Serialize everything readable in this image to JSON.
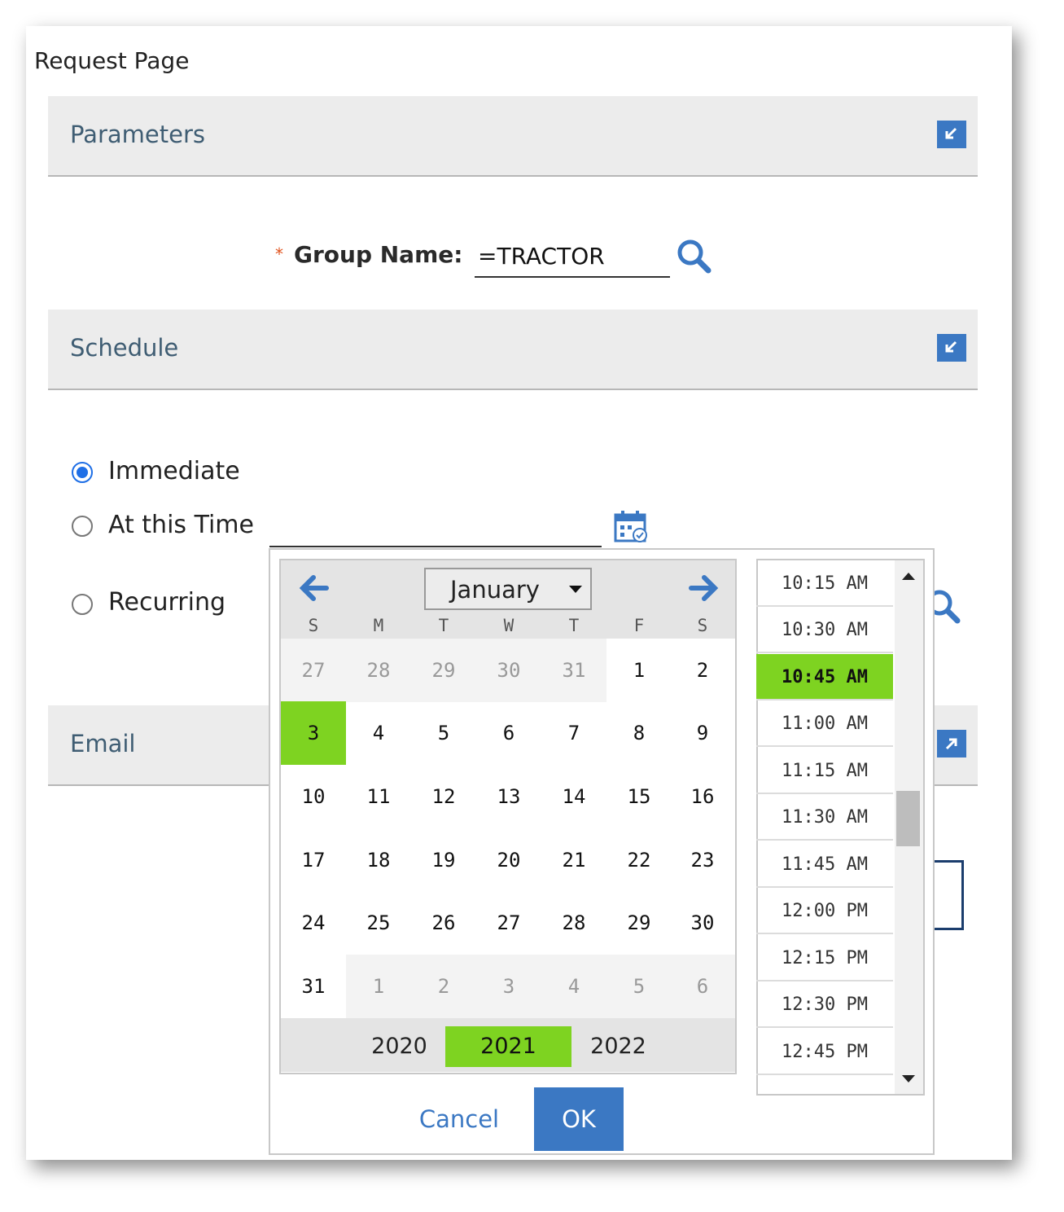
{
  "page_title": "Request Page",
  "sections": {
    "parameters": "Parameters",
    "schedule": "Schedule",
    "email": "Email"
  },
  "group": {
    "required_marker": "*",
    "label": "Group Name:",
    "value": "=TRACTOR"
  },
  "schedule": {
    "options": [
      "Immediate",
      "At this Time",
      "Recurring"
    ],
    "selected": "Immediate"
  },
  "calendar": {
    "month": "January",
    "weekdays": [
      "S",
      "M",
      "T",
      "W",
      "T",
      "F",
      "S"
    ],
    "days": [
      "27",
      "28",
      "29",
      "30",
      "31",
      "1",
      "2",
      "3",
      "4",
      "5",
      "6",
      "7",
      "8",
      "9",
      "10",
      "11",
      "12",
      "13",
      "14",
      "15",
      "16",
      "17",
      "18",
      "19",
      "20",
      "21",
      "22",
      "23",
      "24",
      "25",
      "26",
      "27",
      "28",
      "29",
      "30",
      "31",
      "1",
      "2",
      "3",
      "4",
      "5",
      "6"
    ],
    "selected_day": "3",
    "years": [
      "2020",
      "2021",
      "2022"
    ],
    "selected_year": "2021"
  },
  "times": {
    "items": [
      "10:15 AM",
      "10:30 AM",
      "10:45 AM",
      "11:00 AM",
      "11:15 AM",
      "11:30 AM",
      "11:45 AM",
      "12:00 PM",
      "12:15 PM",
      "12:30 PM",
      "12:45 PM"
    ],
    "selected": "10:45 AM"
  },
  "buttons": {
    "cancel": "Cancel",
    "ok": "OK"
  },
  "colors": {
    "accent": "#3b78c3",
    "selected": "#7ed321",
    "radio": "#1f6fe6",
    "required": "#e0521c"
  }
}
